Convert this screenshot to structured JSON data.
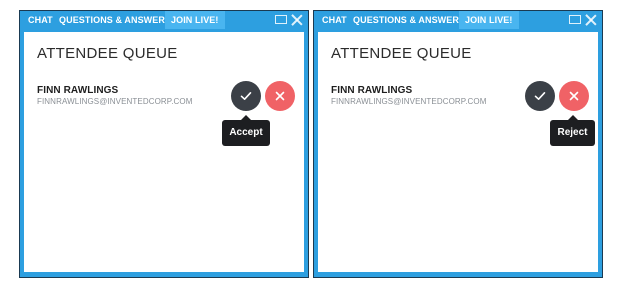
{
  "panels": [
    {
      "tabs": [
        "CHAT",
        "QUESTIONS & ANSWERS",
        "JOIN LIVE!"
      ],
      "active_tab": "JOIN LIVE!",
      "queue_title": "ATTENDEE QUEUE",
      "attendee": {
        "name": "FINN RAWLINGS",
        "email": "FINNRAWLINGS@INVENTEDCORP.COM"
      },
      "tooltip": "Accept"
    },
    {
      "tabs": [
        "CHAT",
        "QUESTIONS & ANSWERS",
        "JOIN LIVE!"
      ],
      "active_tab": "JOIN LIVE!",
      "queue_title": "ATTENDEE QUEUE",
      "attendee": {
        "name": "FINN RAWLINGS",
        "email": "FINNRAWLINGS@INVENTEDCORP.COM"
      },
      "tooltip": "Reject"
    }
  ],
  "icons": {
    "accept": "check-icon",
    "reject": "close-icon",
    "window_restore": "window-restore-icon",
    "window_close": "window-close-icon"
  },
  "colors": {
    "panel_frame": "#2d9fe0",
    "active_tab": "#49b5f0",
    "accept_button": "#3b4047",
    "reject_button": "#f06266",
    "tooltip_bg": "#1d1e21"
  }
}
